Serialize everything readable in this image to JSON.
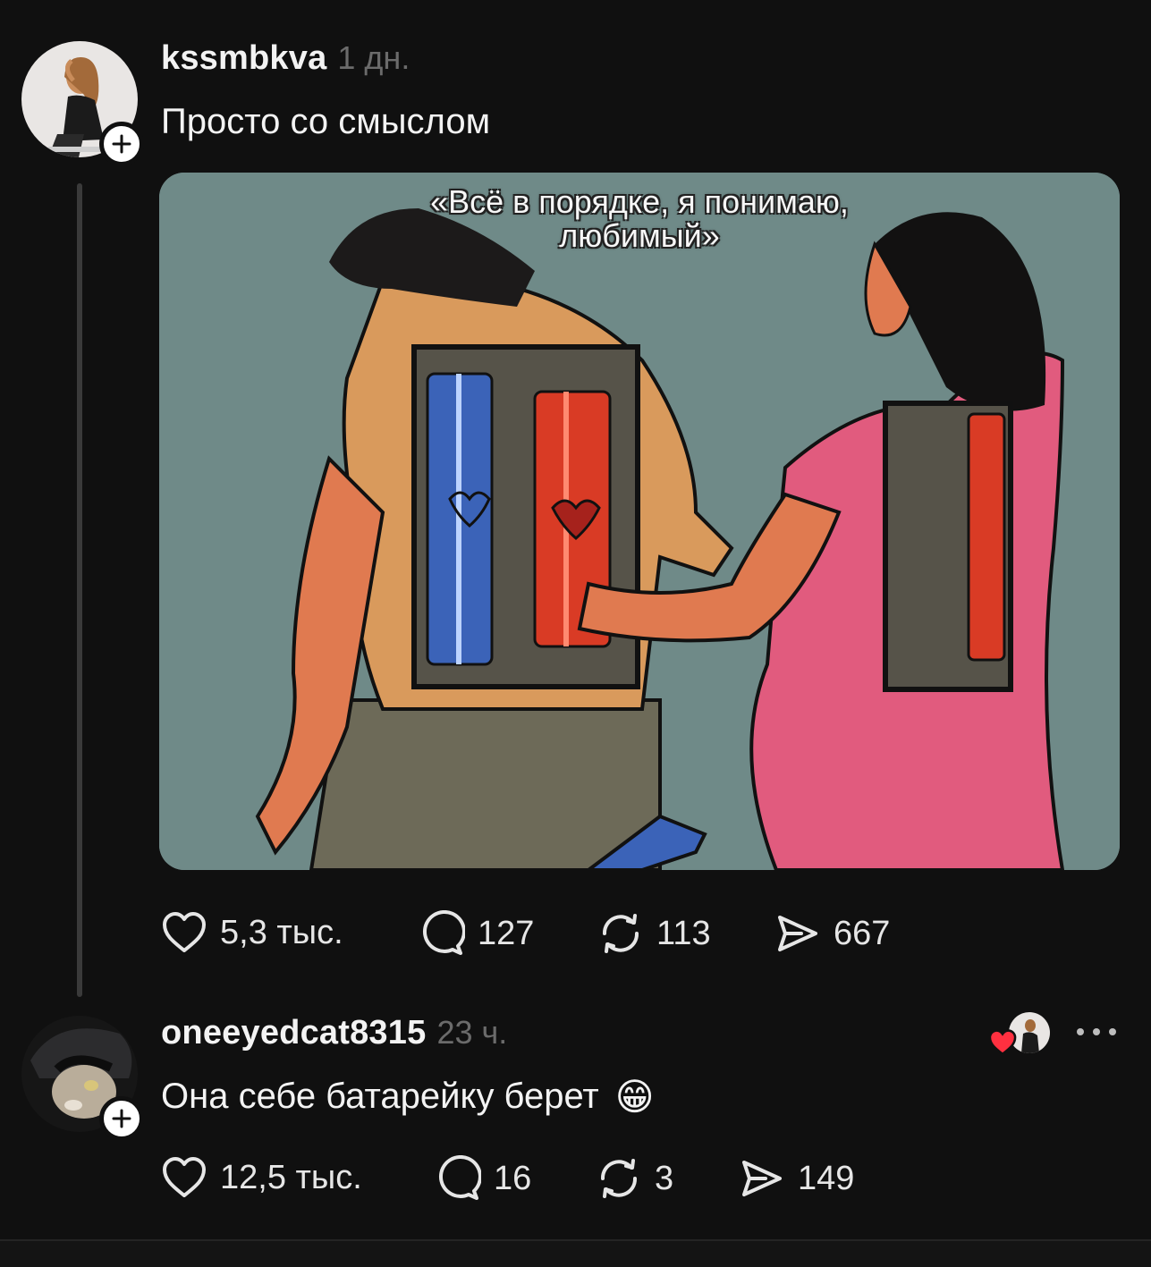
{
  "post": {
    "username": "kssmbkva",
    "time": "1 дн.",
    "text": "Просто со смыслом",
    "image_caption_line1": "«Всё в порядке, я понимаю,",
    "image_caption_line2": "любимый»",
    "actions": {
      "likes": "5,3 тыс.",
      "comments": "127",
      "reposts": "113",
      "shares": "667"
    }
  },
  "reply": {
    "username": "oneeyedcat8315",
    "time": "23 ч.",
    "text": "Она себе батарейку берет",
    "emoji": "😁",
    "actions": {
      "likes": "12,5 тыс.",
      "comments": "16",
      "reposts": "3",
      "shares": "149"
    }
  },
  "icons": {
    "heart": "heart-icon",
    "comment": "comment-icon",
    "repost": "repost-icon",
    "share": "share-icon",
    "more": "more-icon",
    "plus": "plus-icon"
  },
  "colors": {
    "background": "#101010",
    "text": "#f3f3f3",
    "muted": "#6b6b6b",
    "liked_heart": "#ff3040"
  }
}
